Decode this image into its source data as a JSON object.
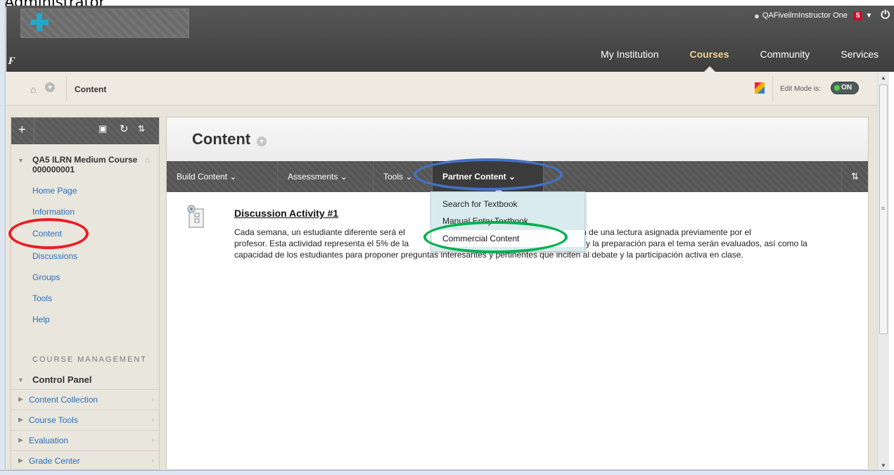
{
  "caption": "Administrator",
  "header": {
    "user_name": "QAFiveilrnInstructor One",
    "notification_count": "5",
    "nav_tabs": [
      "My Institution",
      "Courses",
      "Community",
      "Services"
    ],
    "active_tab": "Courses"
  },
  "breadcrumb": {
    "current": "Content",
    "edit_mode_label": "Edit Mode is:",
    "edit_mode_value": "ON"
  },
  "sidebar": {
    "course_title": "QA5 ILRN Medium Course 000000001",
    "items": [
      "Home Page",
      "Information",
      "Content",
      "Discussions",
      "Groups",
      "Tools",
      "Help"
    ],
    "management_heading": "COURSE MANAGEMENT",
    "control_panel_title": "Control Panel",
    "control_panel_items": [
      "Content Collection",
      "Course Tools",
      "Evaluation",
      "Grade Center"
    ]
  },
  "main": {
    "title": "Content",
    "action_bar": [
      "Build Content",
      "Assessments",
      "Tools",
      "Partner Content"
    ],
    "content_item": {
      "title": "Discussion Activity #1",
      "description_line1": "Cada semana, un estudiante diferente será el",
      "description_line1b": "ir la discusión de una lectura asignada previamente por el",
      "description_line2": "profesor. Esta actividad representa el 5% de la",
      "description_line2b": "y la preparación para el tema serán evaluados, así como la",
      "description_line3": "capacidad de los estudiantes para proponer preguntas interesantes y pertinentes que inciten al debate y la participación activa en clase."
    }
  },
  "dropdown": {
    "items": [
      "Search for Textbook",
      "Manual Entry Textbook",
      "Commercial Content"
    ]
  },
  "colors": {
    "annotation_red": "#ee1c24",
    "annotation_blue": "#4472c4",
    "annotation_green": "#00b04f",
    "link_blue": "#2a6ebb"
  }
}
